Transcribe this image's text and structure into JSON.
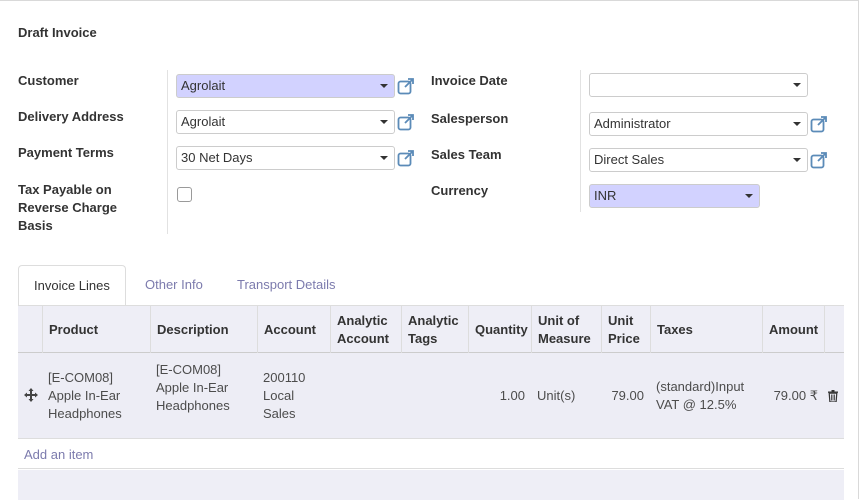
{
  "status_title": "Draft Invoice",
  "left_fields": {
    "customer": {
      "label": "Customer",
      "value": "Agrolait"
    },
    "delivery_address": {
      "label": "Delivery Address",
      "value": "Agrolait"
    },
    "payment_terms": {
      "label": "Payment Terms",
      "value": "30 Net Days"
    },
    "tax_payable": {
      "label": "Tax Payable on Reverse Charge Basis",
      "checked": false
    }
  },
  "right_fields": {
    "invoice_date": {
      "label": "Invoice Date",
      "value": ""
    },
    "salesperson": {
      "label": "Salesperson",
      "value": "Administrator"
    },
    "sales_team": {
      "label": "Sales Team",
      "value": "Direct Sales"
    },
    "currency": {
      "label": "Currency",
      "value": "INR"
    }
  },
  "tabs": [
    {
      "label": "Invoice Lines",
      "active": true
    },
    {
      "label": "Other Info",
      "active": false
    },
    {
      "label": "Transport Details",
      "active": false
    }
  ],
  "table": {
    "headers": {
      "product": "Product",
      "description": "Description",
      "account": "Account",
      "analytic_account": "Analytic Account",
      "analytic_tags": "Analytic Tags",
      "quantity": "Quantity",
      "uom": "Unit of Measure",
      "unit_price": "Unit Price",
      "taxes": "Taxes",
      "amount": "Amount"
    },
    "rows": [
      {
        "product": "[E-COM08] Apple In-Ear Headphones",
        "description": "[E-COM08] Apple In-Ear Headphones",
        "account": "200110 Local Sales",
        "analytic_account": "",
        "analytic_tags": "",
        "quantity": "1.00",
        "uom": "Unit(s)",
        "unit_price": "79.00",
        "taxes": "(standard)Input VAT @ 12.5%",
        "amount": "79.00 ₹"
      }
    ],
    "add_item": "Add an item"
  },
  "colors": {
    "required_bg": "#d2d2ff",
    "link": "#7c7bad",
    "header_bg": "#eeeef6"
  },
  "icons": {
    "external_link": "external-link-icon",
    "drag_handle": "drag-handle-icon",
    "trash": "trash-icon",
    "dropdown": "chevron-down-icon"
  }
}
